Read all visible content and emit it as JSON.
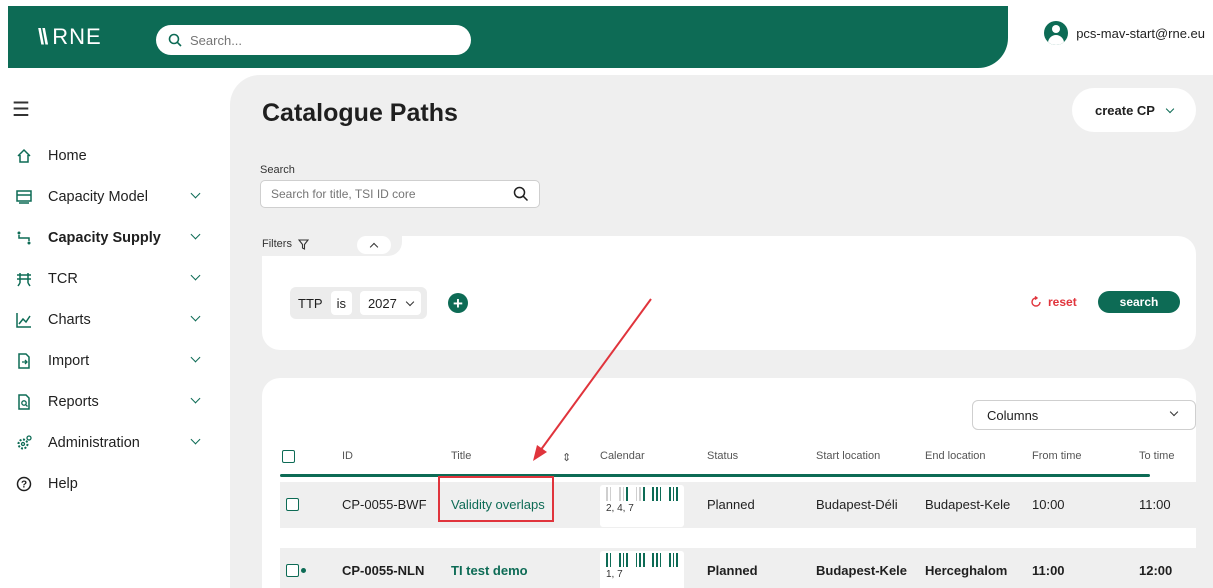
{
  "header": {
    "logo_mark": "\\\\",
    "logo_text": "RNE",
    "search_placeholder": "Search...",
    "user_email": "pcs-mav-start@rne.eu",
    "brand_color": "#0d6b55"
  },
  "sidebar": {
    "items": [
      {
        "label": "Home",
        "icon": "home-icon",
        "chevron": false,
        "active": false
      },
      {
        "label": "Capacity Model",
        "icon": "capacity-model-icon",
        "chevron": true,
        "active": false
      },
      {
        "label": "Capacity Supply",
        "icon": "capacity-supply-icon",
        "chevron": true,
        "active": true
      },
      {
        "label": "TCR",
        "icon": "tcr-icon",
        "chevron": true,
        "active": false
      },
      {
        "label": "Charts",
        "icon": "chart-icon",
        "chevron": true,
        "active": false
      },
      {
        "label": "Import",
        "icon": "import-icon",
        "chevron": true,
        "active": false
      },
      {
        "label": "Reports",
        "icon": "reports-icon",
        "chevron": true,
        "active": false
      },
      {
        "label": "Administration",
        "icon": "gear-icon",
        "chevron": true,
        "active": false
      },
      {
        "label": "Help",
        "icon": "help-icon",
        "chevron": false,
        "active": false
      }
    ]
  },
  "main": {
    "title": "Catalogue Paths",
    "create_label": "create CP",
    "search_label": "Search",
    "search_placeholder": "Search for title, TSI ID core",
    "filters_label": "Filters",
    "filter": {
      "field": "TTP",
      "operator": "is",
      "value": "2027"
    },
    "reset_label": "reset",
    "search_button": "search",
    "columns_label": "Columns",
    "table": {
      "headers": [
        "ID",
        "Title",
        "Calendar",
        "Status",
        "Start location",
        "End location",
        "From time",
        "To time"
      ],
      "rows": [
        {
          "id": "CP-0055-BWF",
          "title": "Validity overlaps",
          "calendar_days": "2, 4, 7",
          "status": "Planned",
          "start": "Budapest-Déli",
          "end": "Budapest-Kele",
          "from": "10:00",
          "to": "11:00"
        },
        {
          "id": "CP-0055-NLN",
          "title": "TI test demo",
          "calendar_days": "1, 7",
          "status": "Planned",
          "start": "Budapest-Kele",
          "end": "Herceghalom",
          "from": "11:00",
          "to": "12:00"
        }
      ]
    }
  },
  "annotation_color": "#e0343c"
}
